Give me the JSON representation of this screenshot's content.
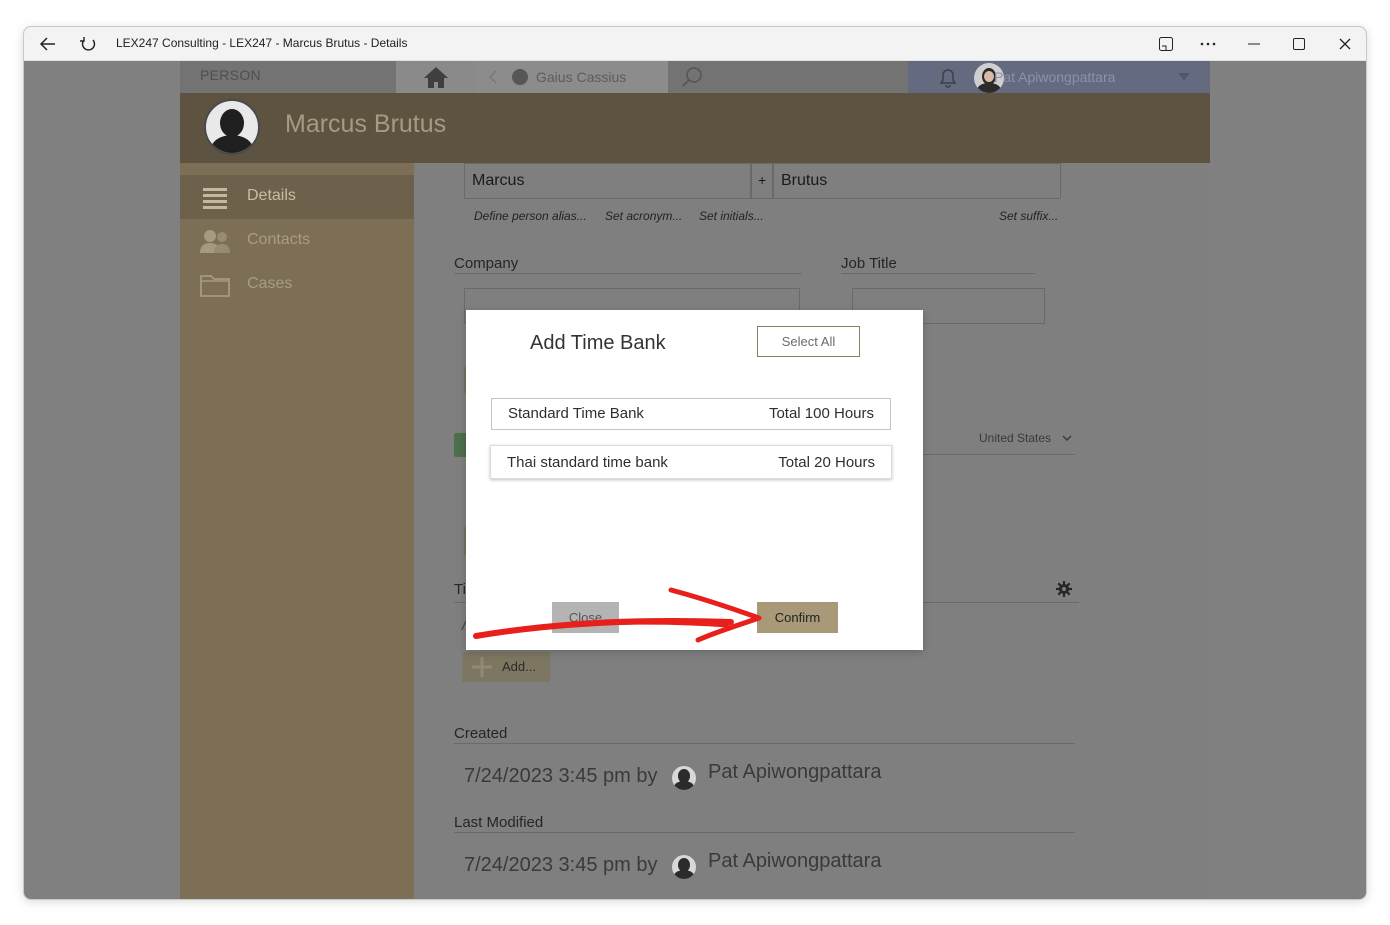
{
  "window": {
    "title": "LEX247 Consulting - LEX247 - Marcus Brutus - Details"
  },
  "nav": {
    "person_label": "PERSON",
    "recent_person": "Gaius Cassius",
    "user_name": "Pat Apiwongpattara"
  },
  "header": {
    "title": "Marcus Brutus"
  },
  "sidebar": {
    "items": [
      {
        "label": "Details",
        "icon": "list-icon"
      },
      {
        "label": "Contacts",
        "icon": "contacts-icon"
      },
      {
        "label": "Cases",
        "icon": "folder-icon"
      }
    ]
  },
  "form": {
    "first_name": "Marcus",
    "plus": "+",
    "last_name": "Brutus",
    "hint_alias": "Define person alias...",
    "hint_acronym": "Set acronym...",
    "hint_initials": "Set initials...",
    "hint_suffix": "Set suffix...",
    "company_label": "Company",
    "job_title_label": "Job Title",
    "country": "United States",
    "ti_label": "Ti",
    "add_label": "Add...",
    "created_label": "Created",
    "created_value": "7/24/2023 3:45 pm by",
    "created_by": "Pat Apiwongpattara",
    "modified_label": "Last Modified",
    "modified_value": "7/24/2023 3:45 pm by",
    "modified_by": "Pat Apiwongpattara"
  },
  "dialog": {
    "title": "Add Time Bank",
    "select_all": "Select All",
    "rows": [
      {
        "name": "Standard Time Bank",
        "total": "Total 100 Hours"
      },
      {
        "name": "Thai standard time bank",
        "total": "Total 20 Hours"
      }
    ],
    "close_label": "Close",
    "confirm_label": "Confirm"
  },
  "colors": {
    "accent": "#a89a78",
    "header": "#5d5340",
    "sidebar": "#7d6f56",
    "annotation_arrow": "#e8201c"
  }
}
